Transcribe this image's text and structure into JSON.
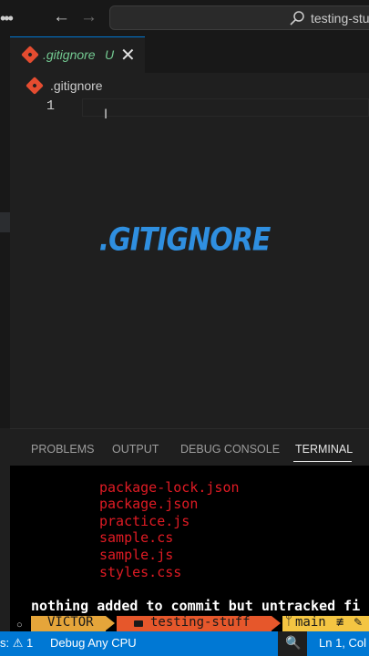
{
  "titlebar": {
    "menu_glyph": "•••",
    "back_glyph": "←",
    "forward_glyph": "→",
    "search_text": "testing-stuff"
  },
  "tab": {
    "label": ".gitignore",
    "status": "U",
    "close_glyph": "✕"
  },
  "breadcrumb": {
    "label": ".gitignore"
  },
  "editor": {
    "line_number": "1",
    "cursor_glyph": "I",
    "overlay_title": ".GITIGNORE"
  },
  "panel": {
    "tabs": [
      "PROBLEMS",
      "OUTPUT",
      "DEBUG CONSOLE",
      "TERMINAL"
    ],
    "active_tab": "TERMINAL"
  },
  "terminal": {
    "untracked_files": [
      "package-lock.json",
      "package.json",
      "practice.js",
      "sample.cs",
      "sample.js",
      "styles.css"
    ],
    "message": "nothing added to commit but untracked fi",
    "prompt": {
      "circle": "○",
      "user": "VICTOR",
      "directory": "testing-stuff",
      "branch_glyph": "ᛘ",
      "branch": "main",
      "branch_status": "≢",
      "edit_glyph": "✎"
    }
  },
  "statusbar": {
    "problems": "s: ⚠ 1",
    "debug": "Debug Any CPU",
    "zoom_glyph": "🔍",
    "position": "Ln 1, Col"
  },
  "colors": {
    "accent": "#0078d4",
    "untracked": "#73c991",
    "terminal_red": "#e01b24",
    "prompt_user": "#e5a53a",
    "prompt_dir": "#e6572b",
    "prompt_git": "#f4c542",
    "overlay_title": "#2f8fe0"
  }
}
